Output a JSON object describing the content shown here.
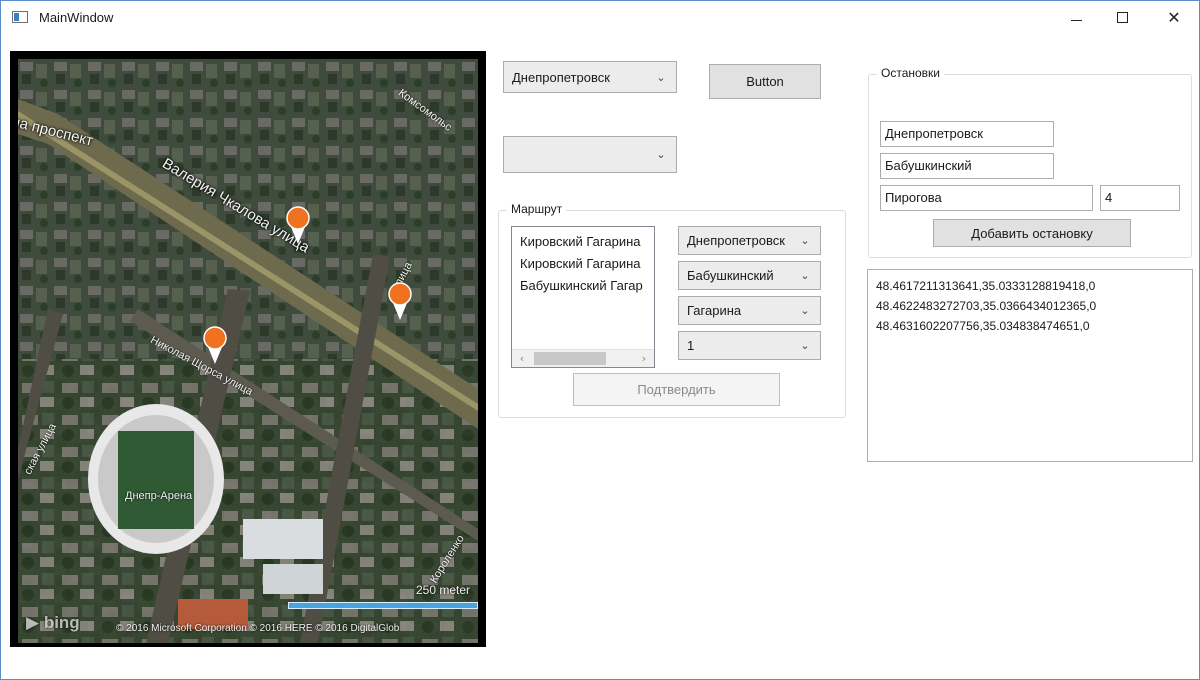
{
  "window": {
    "title": "MainWindow"
  },
  "map": {
    "labels": {
      "prospect": "на проспект",
      "chkalova": "Валерия Чкалова улица",
      "komsomolsk": "Комсомольс",
      "ulitsa_right": "улица",
      "shchorsa": "Николая Щорса улица",
      "left_street": "ская улица",
      "korolenko": "Короленко",
      "arena": "Днепр-Арена"
    },
    "scale": "250 meter",
    "copyright": "© 2016 Microsoft Corporation   © 2016 HERE   © 2016 DigitalGlob",
    "brand": "bing",
    "colors": {
      "pin": "#f0711f",
      "scale_bar": "#49a3e0"
    }
  },
  "top": {
    "city_combo": "Днепропетровск",
    "button_label": "Button",
    "second_combo": ""
  },
  "route": {
    "legend": "Маршрут",
    "items": [
      "Кировский Гагарина",
      "Кировский Гагарина",
      "Бабушкинский Гагар"
    ],
    "combo_city": "Днепропетровск",
    "combo_district": "Бабушкинский",
    "combo_street": "Гагарина",
    "combo_number": "1",
    "confirm_label": "Подтвердить"
  },
  "stops": {
    "legend": "Остановки",
    "city": "Днепропетровск",
    "district": "Бабушкинский",
    "street": "Пирогова",
    "number": "4",
    "add_label": "Добавить остановку"
  },
  "coords": {
    "lines": [
      "48.4617211313641,35.0333128819418,0",
      "48.4622483272703,35.0366434012365,0",
      "48.4631602207756,35.034838474651,0"
    ]
  }
}
